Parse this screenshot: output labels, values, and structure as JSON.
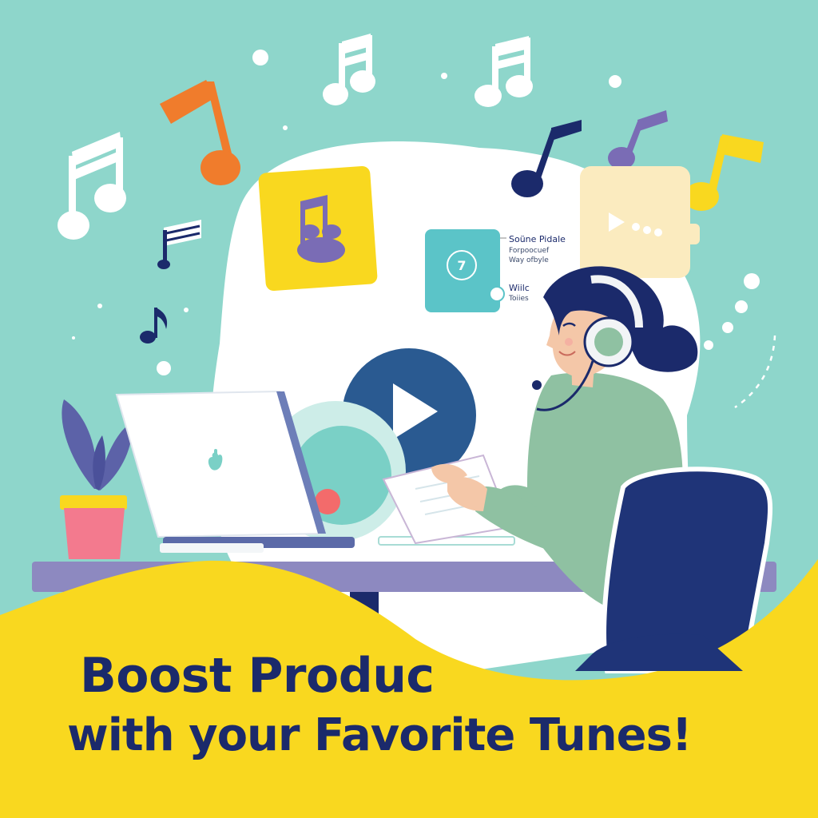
{
  "headline": {
    "line1": "Boost Produc",
    "line2": "with your Favorite Tunes!"
  },
  "info_panel": {
    "badge": "7",
    "title": "Soüne Pidale",
    "subtitle1": "Forpoocuef",
    "subtitle2": "Way ofbyle",
    "label1": "Wiilc",
    "label2": "Toiies"
  },
  "colors": {
    "background": "#8ED6CB",
    "cloud": "#FFFFFF",
    "banner": "#F9D81F",
    "navy": "#1B2A6B",
    "orange": "#F07C2C",
    "purple": "#7A6CB5",
    "teal_card": "#5BC4C8",
    "cream_card": "#FBEBBF"
  },
  "icons": [
    "music-note-icon",
    "play-icon",
    "apple-logo-icon",
    "headphones-icon",
    "plant-icon"
  ]
}
